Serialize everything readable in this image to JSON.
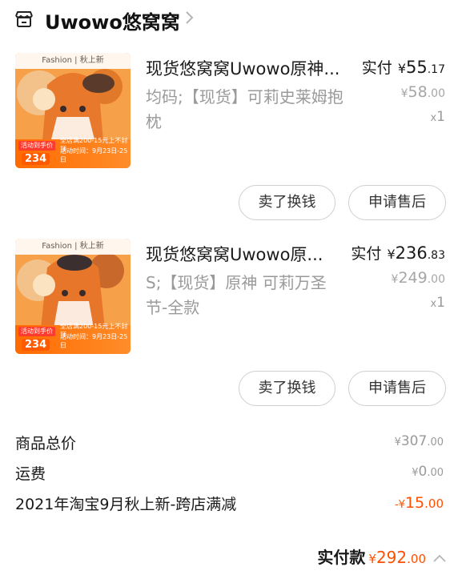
{
  "shop": {
    "name": "Uwowo悠窝窝",
    "icon": "store-icon",
    "chevron": "chevron-right-icon"
  },
  "items": [
    {
      "title": "现货悠窝窝Uwowo原神...",
      "sku": "均码;【现货】可莉史莱姆抱枕",
      "paid_label": "实付",
      "currency": "¥",
      "paid_int": "55",
      "paid_dec": ".17",
      "orig_int": "58",
      "orig_dec": ".00",
      "qty_x": "x",
      "qty": "1",
      "thumb": {
        "banner": "Fashion | 秋上新",
        "promo_label": "活动到手价",
        "promo_price": "234",
        "note1": "全店满200-15元上不封顶",
        "note2": "活动时间：9月23日-25日"
      },
      "buttons": {
        "sell": "卖了换钱",
        "after_sale": "申请售后"
      }
    },
    {
      "title": "现货悠窝窝Uwowo原...",
      "sku": "S;【现货】原神 可莉万圣节-全款",
      "paid_label": "实付",
      "currency": "¥",
      "paid_int": "236",
      "paid_dec": ".83",
      "orig_int": "249",
      "orig_dec": ".00",
      "qty_x": "x",
      "qty": "1",
      "thumb": {
        "banner": "Fashion | 秋上新",
        "promo_label": "活动到手价",
        "promo_price": "234",
        "note1": "全店满200-15元上不封顶",
        "note2": "活动时间：9月23日-25日"
      },
      "buttons": {
        "sell": "卖了换钱",
        "after_sale": "申请售后"
      }
    }
  ],
  "summary": {
    "subtotal_label": "商品总价",
    "subtotal_yen": "¥",
    "subtotal_int": "307",
    "subtotal_dec": ".00",
    "shipping_label": "运费",
    "shipping_yen": "¥",
    "shipping_int": "0",
    "shipping_dec": ".00",
    "discount_label": "2021年淘宝9月秋上新-跨店满减",
    "discount_yen": "-¥",
    "discount_int": "15",
    "discount_dec": ".00",
    "total_label": "实付款",
    "total_yen": "¥",
    "total_int": "292",
    "total_dec": ".00"
  },
  "colors": {
    "accent": "#ff5000",
    "muted": "#9a9a9a",
    "thumb_orange": "#f59a3a"
  }
}
